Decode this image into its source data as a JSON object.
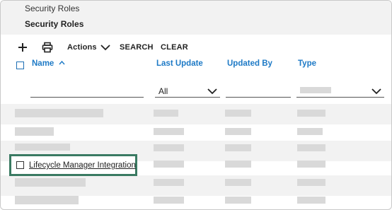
{
  "breadcrumb": "Security Roles",
  "page_title": "Security Roles",
  "toolbar": {
    "add_icon": "plus-icon",
    "print_icon": "printer-icon",
    "actions_label": "Actions",
    "search_label": "SEARCH",
    "clear_label": "CLEAR"
  },
  "columns": {
    "name": "Name",
    "name_sort_icon": "caret-up-icon",
    "last_update": "Last Update",
    "updated_by": "Updated By",
    "type": "Type"
  },
  "filters": {
    "last_update_value": "All"
  },
  "rows": {
    "highlighted_name": "Lifecycle Manager Integration"
  },
  "colors": {
    "accent": "#1e7ac6",
    "highlight_border": "#3a7a62"
  }
}
